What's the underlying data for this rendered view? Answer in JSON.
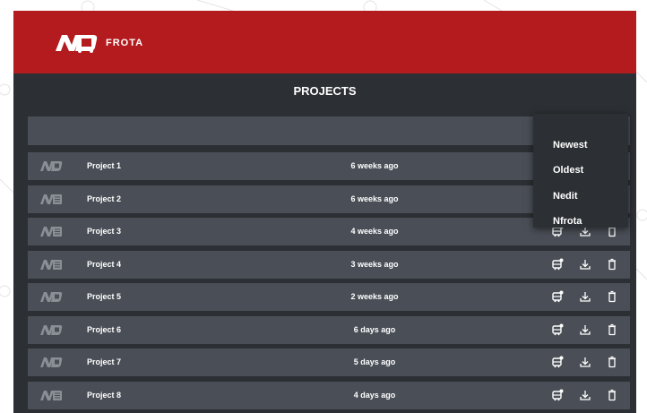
{
  "header": {
    "brand": "FROTA",
    "logo_icon": "nd-logo-icon",
    "background_color": "#b31b1e"
  },
  "page": {
    "title": "PROJECTS"
  },
  "sort_menu": {
    "options": [
      "Newest",
      "Oldest",
      "Nedit",
      "Nfrota"
    ]
  },
  "projects": [
    {
      "name": "Project 1",
      "time": "6 weeks ago",
      "thumb": "nd-logo-thumb-icon"
    },
    {
      "name": "Project 2",
      "time": "6 weeks ago",
      "thumb": "nd-edit-thumb-icon"
    },
    {
      "name": "Project 3",
      "time": "4 weeks ago",
      "thumb": "nd-edit-thumb-icon"
    },
    {
      "name": "Project 4",
      "time": "3 weeks ago",
      "thumb": "nd-edit-thumb-icon"
    },
    {
      "name": "Project 5",
      "time": "2 weeks ago",
      "thumb": "nd-logo-thumb-icon"
    },
    {
      "name": "Project 6",
      "time": "6 days ago",
      "thumb": "nd-logo-thumb-icon"
    },
    {
      "name": "Project 7",
      "time": "5 days ago",
      "thumb": "nd-logo-thumb-icon"
    },
    {
      "name": "Project 8",
      "time": "4 days ago",
      "thumb": "nd-edit-thumb-icon"
    }
  ],
  "row_actions": {
    "open_icon": "bus-settings-icon",
    "download_icon": "download-icon",
    "delete_icon": "trash-icon"
  },
  "colors": {
    "app_background": "#2c2f33",
    "row_background": "#4a4f57",
    "accent": "#b31b1e"
  }
}
